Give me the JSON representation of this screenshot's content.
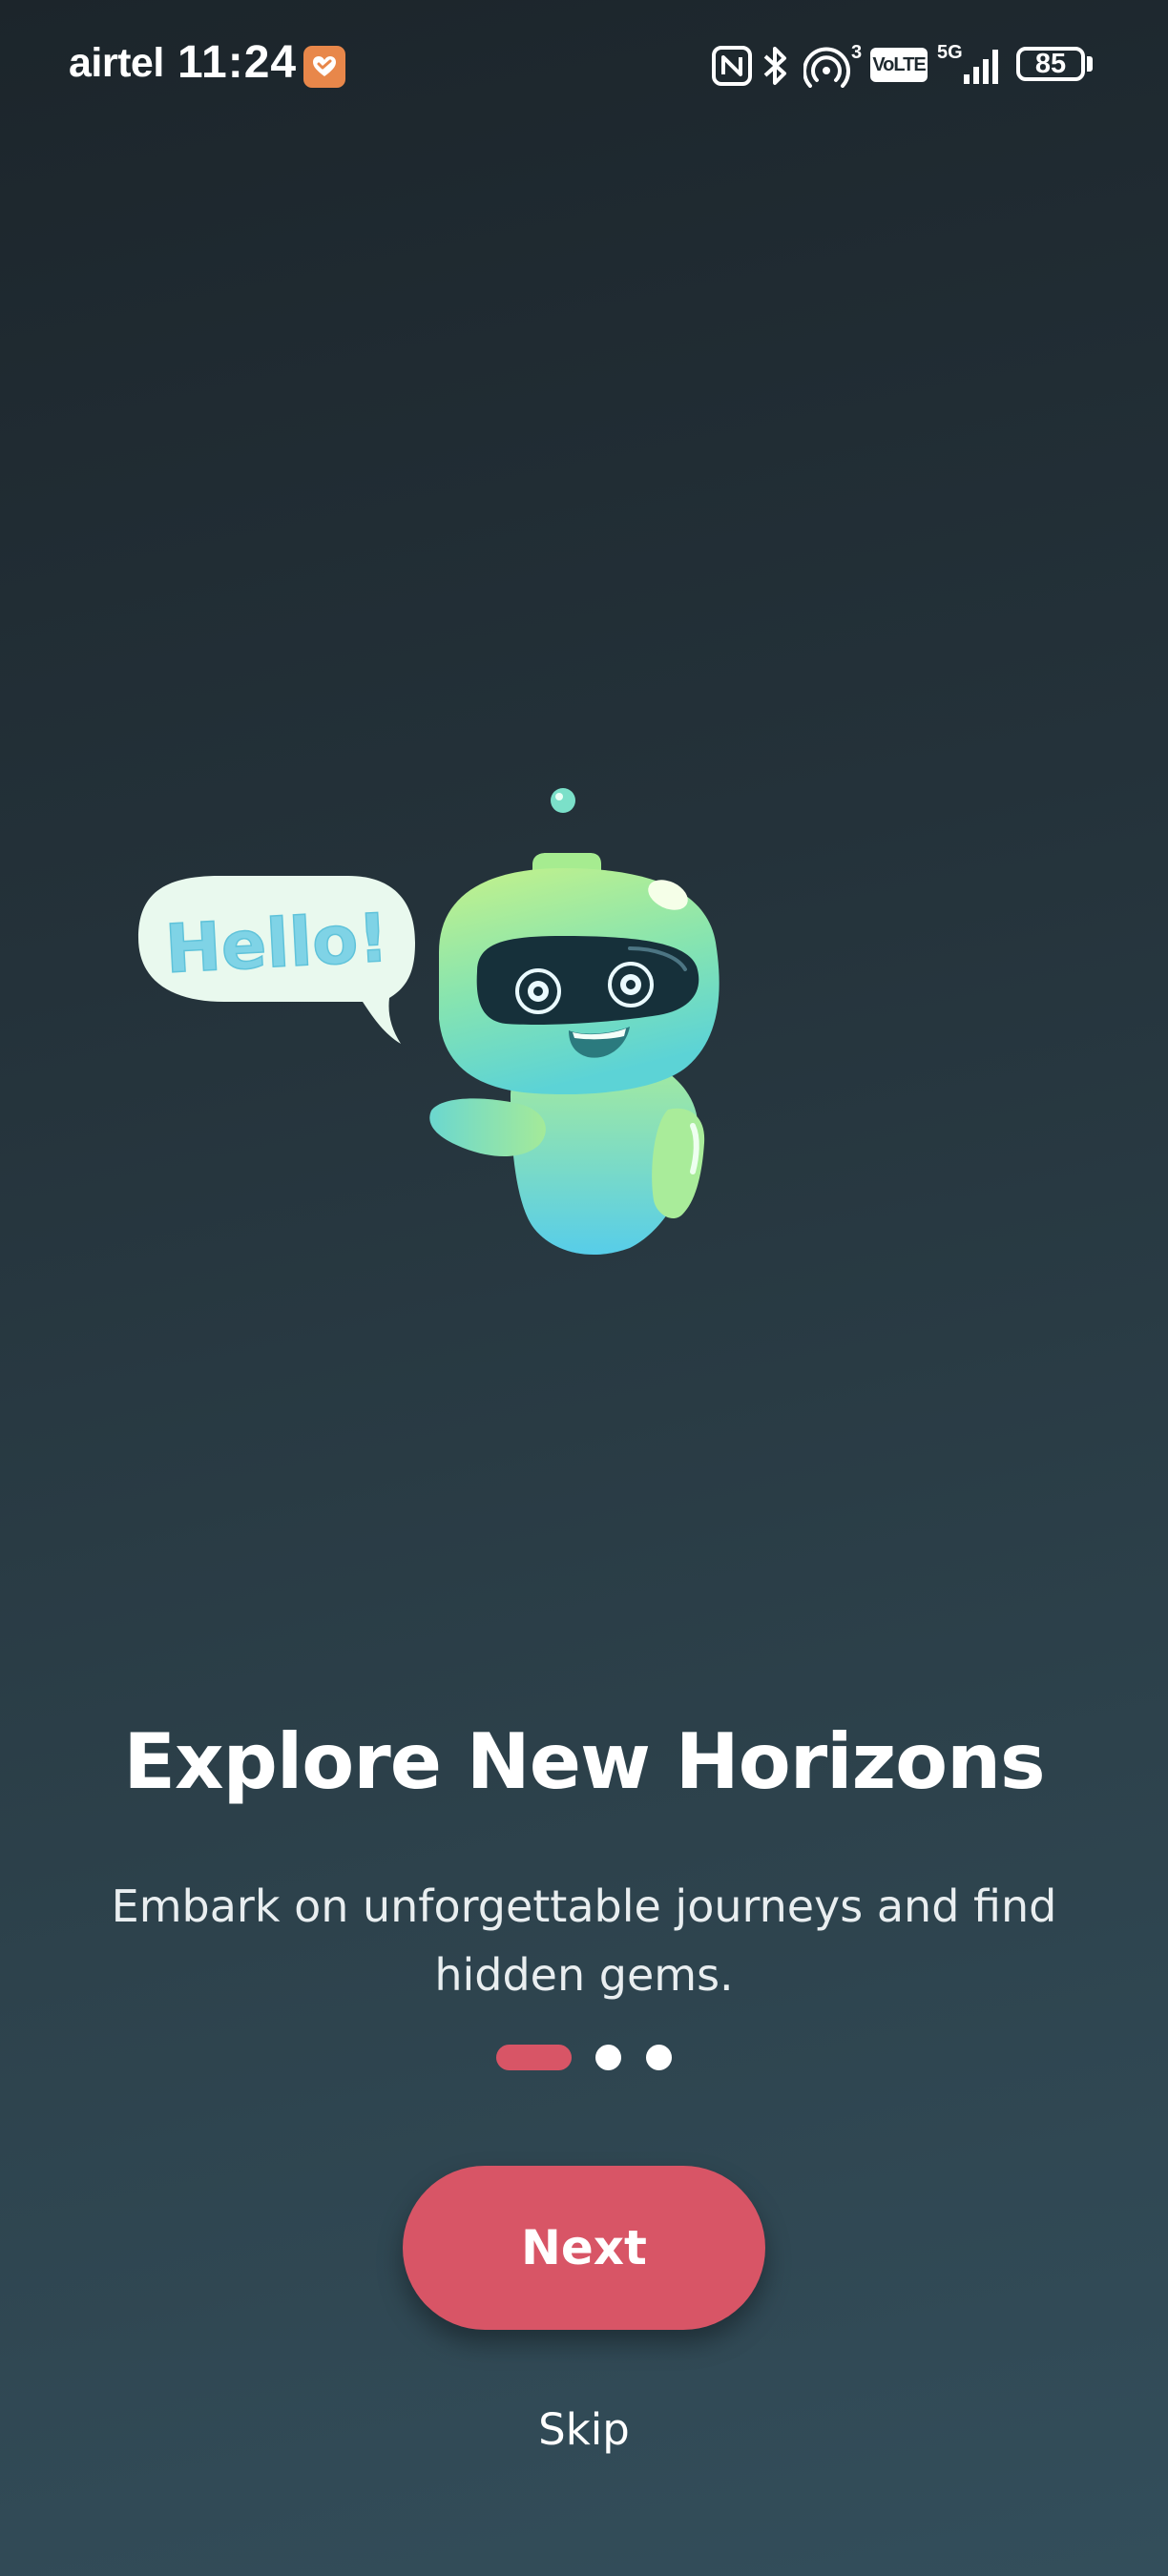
{
  "status_bar": {
    "carrier": "airtel",
    "time": "11:24",
    "battery_level": "85",
    "network_label": "5G",
    "volte_label": "VoLTE",
    "hotspot_count": "3",
    "icons": [
      "nfc-icon",
      "bluetooth-icon",
      "hotspot-icon",
      "volte-icon",
      "signal-icon",
      "battery-icon"
    ]
  },
  "illustration": {
    "speech_bubble_text": "Hello!"
  },
  "onboarding": {
    "title": "Explore New Horizons",
    "description": "Embark on unforgettable journeys and find hidden gems.",
    "page_count": 3,
    "current_page": 1
  },
  "actions": {
    "next_label": "Next",
    "skip_label": "Skip"
  },
  "colors": {
    "accent": "#d85566",
    "background_top": "#1c252b",
    "background_bottom": "#334e5b",
    "robot_green": "#b8f08a",
    "robot_cyan": "#58cde8"
  }
}
